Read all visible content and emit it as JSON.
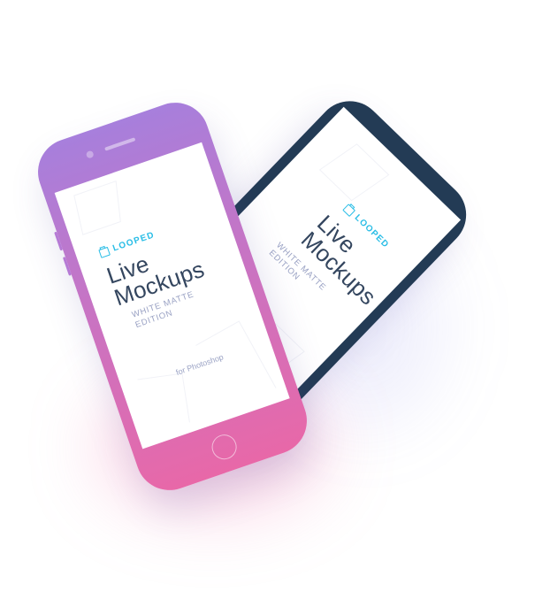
{
  "colors": {
    "back_phone_body": "#233b55",
    "front_gradient_top": "#a77fdc",
    "front_gradient_bottom": "#e868a8",
    "accent_cyan": "#29bde6",
    "title_text": "#34465f",
    "subtitle_text": "#9aa2c4"
  },
  "back_phone": {
    "brand": "LOOPED",
    "title_line1": "Live",
    "title_line2": "Mockups",
    "subtitle_line1": "WHITE MATTE",
    "subtitle_line2": "EDITION"
  },
  "front_phone": {
    "brand": "LOOPED",
    "title_line1": "Live",
    "title_line2": "Mockups",
    "subtitle_line1": "WHITE MATTE",
    "subtitle_line2": "EDITION",
    "footnote": "for Photoshop"
  }
}
